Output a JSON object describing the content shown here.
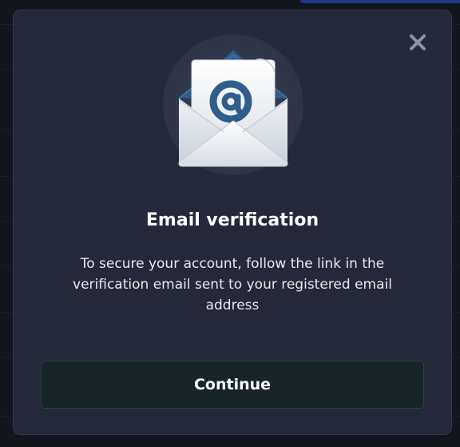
{
  "modal": {
    "title": "Email verification",
    "message": "To secure your account, follow the link in the verification email sent to your registered email address",
    "continue_label": "Continue",
    "close_icon": "close-icon",
    "hero_icon": "envelope-at-icon"
  },
  "colors": {
    "backdrop": "#14161e",
    "modal_bg": "#242838",
    "button_bg": "#182428",
    "button_border": "#1f4a44",
    "envelope_at": "#2f5d8c"
  }
}
